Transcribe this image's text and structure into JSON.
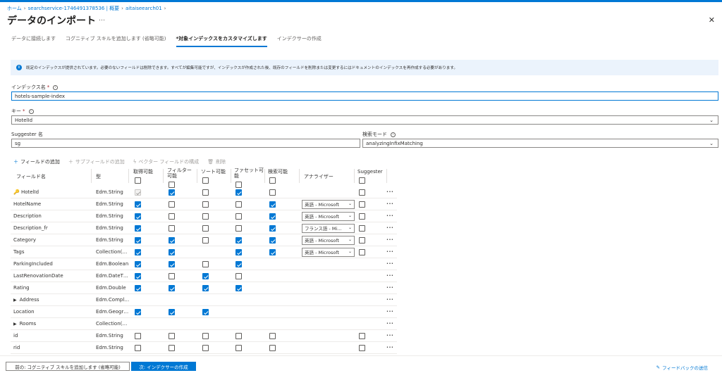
{
  "breadcrumb": [
    "ホーム",
    "searchservice-1746491378536 | 概要",
    "aitaiseearch01"
  ],
  "page": {
    "title": "データのインポート",
    "title_more": "…",
    "close": "✕"
  },
  "tabs": [
    {
      "label": "データに接続します",
      "active": false
    },
    {
      "label": "コグニティブ スキルを追加します (省略可能)",
      "active": false
    },
    {
      "label": "*対象インデックスをカスタマイズします",
      "active": true
    },
    {
      "label": "インデクサーの作成",
      "active": false
    }
  ],
  "info": {
    "icon": "i",
    "text": "既定のインデックスが提供されています。必要のないフィールドは削除できます。すべてが編集可能ですが、インデックスが作成された後、既存のフィールドを削除または変更するにはドキュメントのインデックスを再作成する必要があります。"
  },
  "form": {
    "index_name_label": "インデックス名",
    "index_name_value": "hotels-sample-index",
    "key_label": "キー",
    "key_value": "HotelId",
    "suggester_label": "Suggester 名",
    "suggester_value": "sg",
    "search_mode_label": "検索モード",
    "search_mode_value": "analyzingInfixMatching",
    "required_mark": "*",
    "help_glyph": "i"
  },
  "toolbar": {
    "add_field": "フィールドの追加",
    "add_subfield": "サブフィールドの追加",
    "vector_field": "ベクター フィールドの構成",
    "delete": "削除"
  },
  "columns": {
    "name": "フィールド名",
    "type": "型",
    "retrievable": "取得可能",
    "filterable": "フィルター\n可能",
    "sortable": "ソート可能",
    "facetable": "ファセット可\n能",
    "searchable": "検索可能",
    "analyzer": "アナライザー",
    "suggester": "Suggester"
  },
  "header_checks": {
    "retrievable": false,
    "filterable": false,
    "sortable": false,
    "facetable": false,
    "searchable": false,
    "suggester": false
  },
  "fields": [
    {
      "name": "HotelId",
      "key": true,
      "expand": false,
      "type": "Edm.String",
      "r": true,
      "r_disabled": true,
      "f": true,
      "s": false,
      "fa": true,
      "se": false,
      "analyzer": "",
      "sg": false
    },
    {
      "name": "HotelName",
      "key": false,
      "expand": false,
      "type": "Edm.String",
      "r": true,
      "f": false,
      "s": false,
      "fa": false,
      "se": true,
      "analyzer": "英語 - Microsoft",
      "sg": false
    },
    {
      "name": "Description",
      "key": false,
      "expand": false,
      "type": "Edm.String",
      "r": true,
      "f": false,
      "s": false,
      "fa": false,
      "se": true,
      "analyzer": "英語 - Microsoft",
      "sg": false
    },
    {
      "name": "Description_fr",
      "key": false,
      "expand": false,
      "type": "Edm.String",
      "r": true,
      "f": false,
      "s": false,
      "fa": false,
      "se": true,
      "analyzer": "フランス語 - Mi...",
      "sg": false
    },
    {
      "name": "Category",
      "key": false,
      "expand": false,
      "type": "Edm.String",
      "r": true,
      "f": true,
      "s": false,
      "fa": true,
      "se": true,
      "analyzer": "英語 - Microsoft",
      "sg": false
    },
    {
      "name": "Tags",
      "key": false,
      "expand": false,
      "type": "Collection(…",
      "r": true,
      "f": true,
      "s": null,
      "fa": true,
      "se": true,
      "analyzer": "英語 - Microsoft",
      "sg": false
    },
    {
      "name": "ParkingIncluded",
      "key": false,
      "expand": false,
      "type": "Edm.Boolean",
      "r": true,
      "f": true,
      "s": false,
      "fa": true,
      "se": null,
      "analyzer": "",
      "sg": null
    },
    {
      "name": "LastRenovationDate",
      "key": false,
      "expand": false,
      "type": "Edm.DateT…",
      "r": true,
      "f": false,
      "s": true,
      "fa": false,
      "se": null,
      "analyzer": "",
      "sg": null
    },
    {
      "name": "Rating",
      "key": false,
      "expand": false,
      "type": "Edm.Double",
      "r": true,
      "f": true,
      "s": true,
      "fa": true,
      "se": null,
      "analyzer": "",
      "sg": null
    },
    {
      "name": "Address",
      "key": false,
      "expand": true,
      "type": "Edm.Compl…",
      "r": null,
      "f": null,
      "s": null,
      "fa": null,
      "se": null,
      "analyzer": "",
      "sg": null
    },
    {
      "name": "Location",
      "key": false,
      "expand": false,
      "type": "Edm.Geogr…",
      "r": true,
      "f": true,
      "s": true,
      "fa": null,
      "se": null,
      "analyzer": "",
      "sg": null
    },
    {
      "name": "Rooms",
      "key": false,
      "expand": true,
      "type": "Collection(…",
      "r": null,
      "f": null,
      "s": null,
      "fa": null,
      "se": null,
      "analyzer": "",
      "sg": null
    },
    {
      "name": "id",
      "key": false,
      "expand": false,
      "type": "Edm.String",
      "r": false,
      "f": false,
      "s": false,
      "fa": false,
      "se": false,
      "analyzer": "",
      "sg": false
    },
    {
      "name": "rid",
      "key": false,
      "expand": false,
      "type": "Edm.String",
      "r": false,
      "f": false,
      "s": false,
      "fa": false,
      "se": false,
      "analyzer": "",
      "sg": false
    }
  ],
  "footer": {
    "prev": "前の: コグニティブ スキルを追加します (省略可能)",
    "next": "次: インデクサーの作成",
    "feedback": "フィードバックの送信"
  },
  "colors": {
    "accent": "#0078d4",
    "info_bg": "#ebf3fc"
  }
}
